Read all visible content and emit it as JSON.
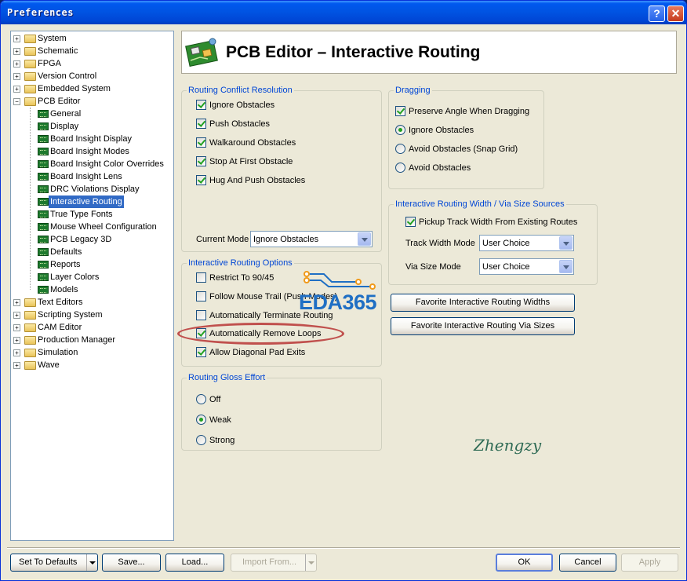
{
  "window": {
    "title": "Preferences",
    "help_glyph": "?",
    "close_glyph": "✕"
  },
  "tree": [
    {
      "label": "System",
      "kind": "folder"
    },
    {
      "label": "Schematic",
      "kind": "folder"
    },
    {
      "label": "FPGA",
      "kind": "folder"
    },
    {
      "label": "Version Control",
      "kind": "folder"
    },
    {
      "label": "Embedded System",
      "kind": "folder"
    },
    {
      "label": "PCB Editor",
      "kind": "folder-open"
    },
    {
      "label": "General",
      "kind": "page"
    },
    {
      "label": "Display",
      "kind": "page"
    },
    {
      "label": "Board Insight Display",
      "kind": "page"
    },
    {
      "label": "Board Insight Modes",
      "kind": "page"
    },
    {
      "label": "Board Insight Color Overrides",
      "kind": "page"
    },
    {
      "label": "Board Insight Lens",
      "kind": "page"
    },
    {
      "label": "DRC Violations Display",
      "kind": "page"
    },
    {
      "label": "Interactive Routing",
      "kind": "page",
      "selected": true
    },
    {
      "label": "True Type Fonts",
      "kind": "page"
    },
    {
      "label": "Mouse Wheel Configuration",
      "kind": "page"
    },
    {
      "label": "PCB Legacy 3D",
      "kind": "page"
    },
    {
      "label": "Defaults",
      "kind": "page"
    },
    {
      "label": "Reports",
      "kind": "page"
    },
    {
      "label": "Layer Colors",
      "kind": "page"
    },
    {
      "label": "Models",
      "kind": "page"
    },
    {
      "label": "Text Editors",
      "kind": "folder"
    },
    {
      "label": "Scripting System",
      "kind": "folder"
    },
    {
      "label": "CAM Editor",
      "kind": "folder"
    },
    {
      "label": "Production Manager",
      "kind": "folder"
    },
    {
      "label": "Simulation",
      "kind": "folder"
    },
    {
      "label": "Wave",
      "kind": "folder"
    }
  ],
  "header": {
    "title": "PCB Editor – Interactive Routing",
    "icon": "pcb-board-icon"
  },
  "conflict": {
    "legend": "Routing Conflict Resolution",
    "options": [
      {
        "label": "Ignore Obstacles",
        "checked": true
      },
      {
        "label": "Push Obstacles",
        "checked": true
      },
      {
        "label": "Walkaround Obstacles",
        "checked": true
      },
      {
        "label": "Stop At First Obstacle",
        "checked": true
      },
      {
        "label": "Hug And Push Obstacles",
        "checked": true
      }
    ],
    "mode_label": "Current Mode",
    "mode_value": "Ignore Obstacles"
  },
  "routing_options": {
    "legend": "Interactive Routing Options",
    "options": [
      {
        "label": "Restrict To 90/45",
        "checked": false
      },
      {
        "label": "Follow Mouse Trail (Push Modes)",
        "checked": false
      },
      {
        "label": "Automatically Terminate Routing",
        "checked": false
      },
      {
        "label": "Automatically Remove Loops",
        "checked": true
      },
      {
        "label": "Allow Diagonal Pad Exits",
        "checked": true
      }
    ]
  },
  "gloss": {
    "legend": "Routing Gloss Effort",
    "options": [
      {
        "label": "Off",
        "checked": false
      },
      {
        "label": "Weak",
        "checked": true
      },
      {
        "label": "Strong",
        "checked": false
      }
    ]
  },
  "dragging": {
    "legend": "Dragging",
    "preserve_label": "Preserve Angle When Dragging",
    "preserve_checked": true,
    "options": [
      {
        "label": "Ignore Obstacles",
        "checked": true
      },
      {
        "label": "Avoid Obstacles (Snap Grid)",
        "checked": false
      },
      {
        "label": "Avoid Obstacles",
        "checked": false
      }
    ]
  },
  "width_sources": {
    "legend": "Interactive Routing Width / Via Size Sources",
    "pickup_label": "Pickup Track Width From Existing Routes",
    "pickup_checked": true,
    "track_label": "Track Width Mode",
    "track_value": "User Choice",
    "via_label": "Via Size Mode",
    "via_value": "User Choice"
  },
  "fav_widths_button": "Favorite Interactive Routing Widths",
  "fav_vias_button": "Favorite Interactive Routing Via Sizes",
  "watermark_text": "EDA365",
  "signature": "Zhengzy",
  "footer": {
    "set_defaults": "Set To Defaults",
    "save": "Save...",
    "load": "Load...",
    "import_from": "Import From...",
    "ok": "OK",
    "cancel": "Cancel",
    "apply": "Apply"
  },
  "colors": {
    "title_bar": "#0054e3",
    "legend_text": "#0046d5",
    "selection": "#316ac5",
    "highlight_ring": "#c0504d",
    "watermark": "#1f6fc4"
  }
}
